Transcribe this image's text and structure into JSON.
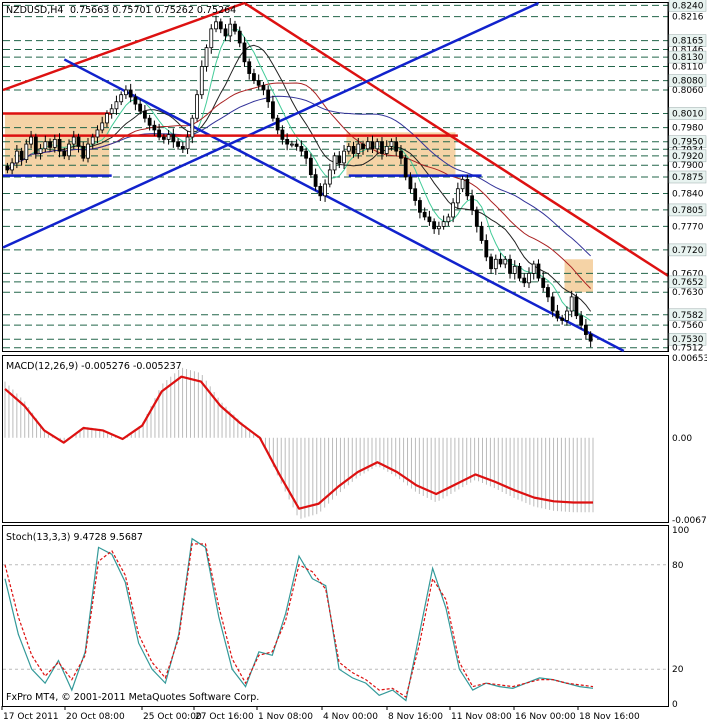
{
  "header": {
    "symbol": "NZDUSD,H4",
    "ohlc": "0.75663 0.75701 0.75262 0.75264"
  },
  "colors": {
    "candle": "#000000",
    "red_line": "#dd1111",
    "blue_line": "#1122cc",
    "box_fill": "#f5d3a6",
    "ma_green": "#44cc99",
    "ma_black": "#222222",
    "ma_darkred": "#aa2222",
    "ma_navy": "#333399",
    "macd_signal": "#dd1111",
    "stoch_main": "#339999",
    "stoch_signal": "#dd1111"
  },
  "chart_data": [
    {
      "type": "candlestick",
      "title": "NZDUSD,H4 0.75663 0.75701 0.75262 0.75264",
      "ylim": [
        0.7505,
        0.8245
      ],
      "price_levels": [
        "0.8240",
        "0.8216",
        "0.8165",
        "0.8146",
        "0.8130",
        "0.8110",
        "0.8080",
        "0.8060",
        "0.8010",
        "0.7980",
        "0.7950",
        "0.7934",
        "0.7920",
        "0.7900",
        "0.7875",
        "0.7840",
        "0.7805",
        "0.7770",
        "0.7720",
        "0.7670",
        "0.7652",
        "0.7630",
        "0.7582",
        "0.7560",
        "0.7530",
        "0.7512"
      ],
      "closes": [
        0.789,
        0.7905,
        0.793,
        0.7912,
        0.7945,
        0.796,
        0.7925,
        0.7935,
        0.795,
        0.7938,
        0.7955,
        0.793,
        0.792,
        0.7945,
        0.796,
        0.794,
        0.7915,
        0.7945,
        0.796,
        0.7975,
        0.799,
        0.801,
        0.802,
        0.8035,
        0.805,
        0.806,
        0.8045,
        0.803,
        0.8015,
        0.8,
        0.7985,
        0.7975,
        0.796,
        0.7955,
        0.7965,
        0.795,
        0.794,
        0.7935,
        0.796,
        0.8,
        0.805,
        0.811,
        0.815,
        0.819,
        0.8205,
        0.819,
        0.8175,
        0.82,
        0.8185,
        0.816,
        0.812,
        0.8095,
        0.808,
        0.807,
        0.806,
        0.8035,
        0.8,
        0.7975,
        0.7955,
        0.7945,
        0.7945,
        0.794,
        0.793,
        0.7915,
        0.788,
        0.7855,
        0.7835,
        0.786,
        0.789,
        0.792,
        0.7905,
        0.793,
        0.794,
        0.7925,
        0.7945,
        0.7935,
        0.795,
        0.7935,
        0.795,
        0.7925,
        0.794,
        0.795,
        0.793,
        0.7915,
        0.7875,
        0.785,
        0.7825,
        0.78,
        0.779,
        0.778,
        0.7765,
        0.777,
        0.778,
        0.779,
        0.782,
        0.785,
        0.787,
        0.7835,
        0.7805,
        0.777,
        0.774,
        0.7705,
        0.768,
        0.77,
        0.769,
        0.77,
        0.767,
        0.7685,
        0.766,
        0.765,
        0.767,
        0.769,
        0.766,
        0.764,
        0.762,
        0.759,
        0.7575,
        0.757,
        0.759,
        0.762,
        0.758,
        0.756,
        0.754,
        0.7526
      ]
    },
    {
      "type": "line",
      "title": "MACD(12,26,9) -0.005276 -0.005237",
      "ylim": [
        -0.00673,
        0.00653
      ],
      "tick_labels": [
        "0.00653",
        "0.00",
        "-0.00673"
      ],
      "signal": [
        0.004,
        0.0026,
        0.0006,
        -0.0004,
        0.0008,
        0.0006,
        -0.0001,
        0.001,
        0.0038,
        0.005,
        0.0046,
        0.0026,
        0.0012,
        0.0,
        -0.003,
        -0.0058,
        -0.0054,
        -0.004,
        -0.0028,
        -0.002,
        -0.0028,
        -0.0039,
        -0.0046,
        -0.0038,
        -0.003,
        -0.0036,
        -0.0043,
        -0.0049,
        -0.0052,
        -0.0053,
        -0.0053
      ]
    },
    {
      "type": "line",
      "title": "Stoch(13,3,3) 9.4728 9.5687",
      "ylim": [
        0,
        100
      ],
      "tick_labels": [
        "100",
        "80",
        "20",
        "0"
      ],
      "main": [
        72,
        40,
        20,
        12,
        25,
        8,
        30,
        90,
        86,
        70,
        35,
        20,
        12,
        40,
        95,
        90,
        50,
        20,
        10,
        30,
        28,
        52,
        85,
        72,
        68,
        20,
        15,
        12,
        5,
        8,
        2,
        40,
        78,
        55,
        20,
        8,
        12,
        10,
        9,
        12,
        15,
        14,
        12,
        10,
        9
      ],
      "signal": [
        80,
        50,
        28,
        16,
        24,
        14,
        28,
        82,
        88,
        74,
        40,
        24,
        15,
        38,
        92,
        92,
        56,
        26,
        12,
        28,
        30,
        48,
        80,
        76,
        66,
        24,
        18,
        14,
        8,
        9,
        4,
        34,
        72,
        60,
        24,
        10,
        12,
        11,
        10,
        12,
        14,
        14,
        12,
        11,
        10
      ]
    }
  ],
  "x_axis": {
    "labels": [
      "17 Oct 2011",
      "20 Oct 08:00",
      "25 Oct 00:00",
      "27 Oct 16:00",
      "1 Nov 08:00",
      "4 Nov 00:00",
      "8 Nov 16:00",
      "11 Nov 08:00",
      "16 Nov 00:00",
      "18 Nov 16:00"
    ]
  },
  "copyright": "FxPro MT4, © 2001-2011 MetaQuotes Software Corp."
}
